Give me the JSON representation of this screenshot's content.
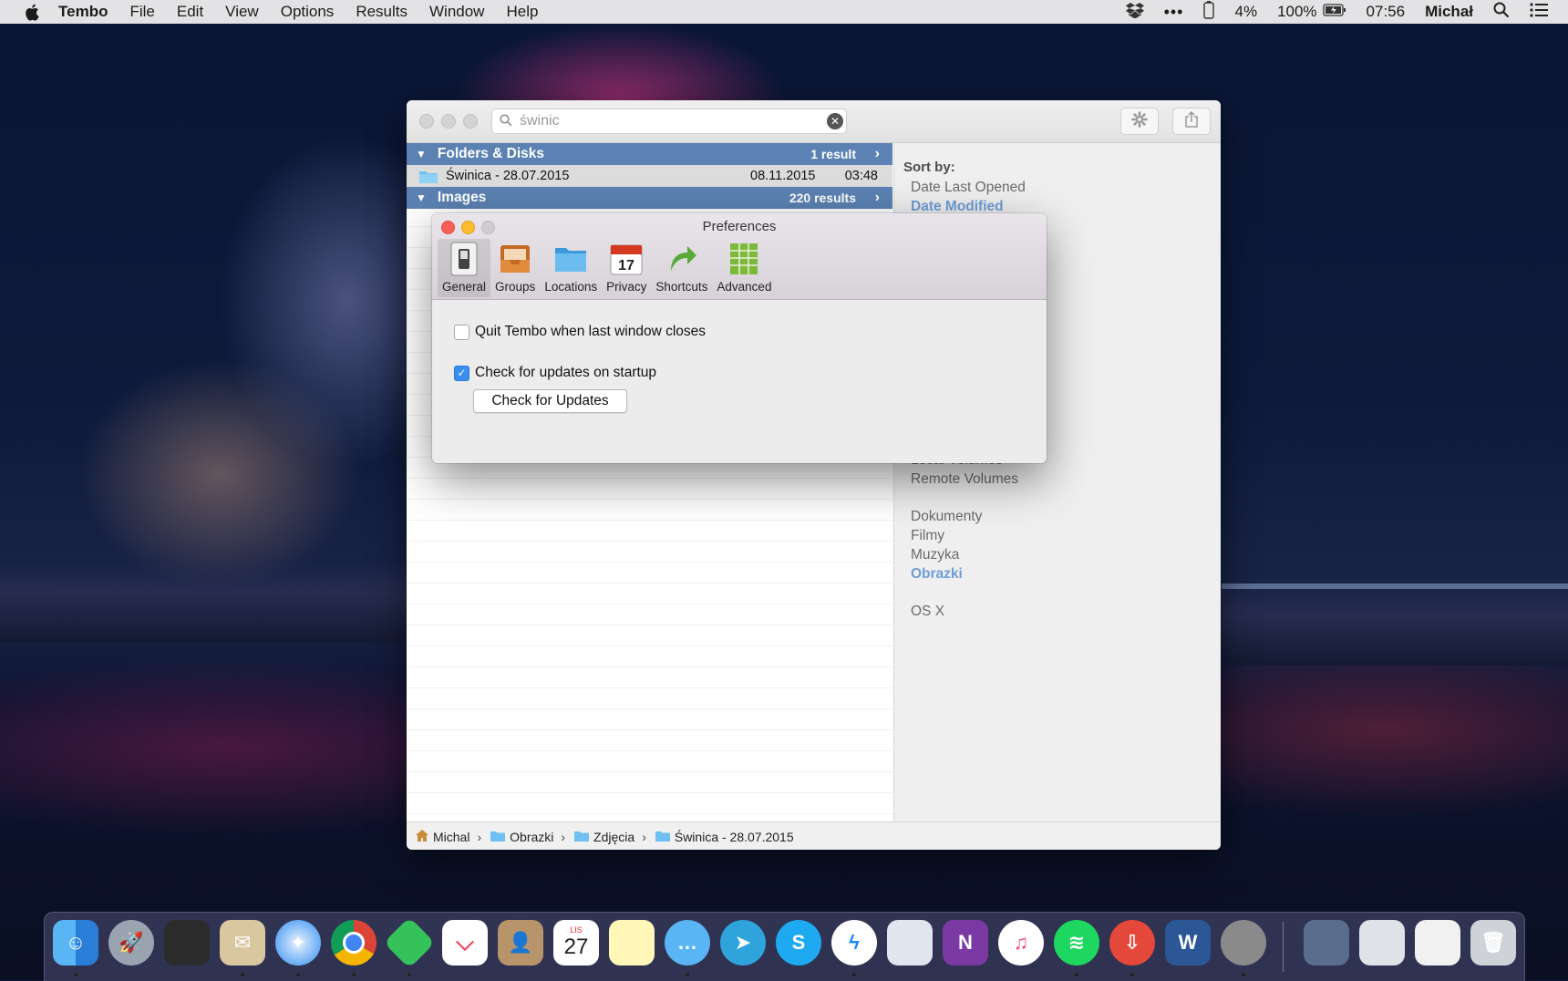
{
  "menubar": {
    "app_name": "Tembo",
    "items": [
      "File",
      "Edit",
      "View",
      "Options",
      "Results",
      "Window",
      "Help"
    ],
    "battery_small": "4%",
    "battery": "100%",
    "time": "07:56",
    "user": "Michał"
  },
  "tembo": {
    "search": {
      "value": "świnic"
    },
    "groups": [
      {
        "title": "Folders & Disks",
        "count": "1 result"
      },
      {
        "title": "Images",
        "count": "220 results"
      }
    ],
    "folder_row": {
      "name": "Świnica - 28.07.2015",
      "date": "08.11.2015",
      "time": "03:48"
    },
    "sidebar": {
      "sort_title": "Sort by:",
      "sort_options": [
        "Date Last Opened",
        "Date Modified"
      ],
      "locations": [
        "Local Volumes",
        "Remote Volumes"
      ],
      "folders": [
        "Dokumenty",
        "Filmy",
        "Muzyka",
        "Obrazki"
      ],
      "system": [
        "OS X"
      ]
    },
    "path": [
      "Michal",
      "Obrazki",
      "Zdjęcia",
      "Świnica - 28.07.2015"
    ]
  },
  "prefs": {
    "title": "Preferences",
    "tabs": [
      "General",
      "Groups",
      "Locations",
      "Privacy",
      "Shortcuts",
      "Advanced"
    ],
    "quit_label": "Quit Tembo when last window closes",
    "quit_checked": false,
    "updates_label": "Check for updates on startup",
    "updates_checked": true,
    "check_button": "Check for Updates",
    "calendar_day": "17"
  },
  "dock": {
    "calendar_month": "LIS",
    "calendar_day": "27"
  },
  "colors": {
    "accent": "#5b82b3",
    "sidebar_active": "#6f9ed7",
    "checkbox": "#3b8ef0"
  }
}
